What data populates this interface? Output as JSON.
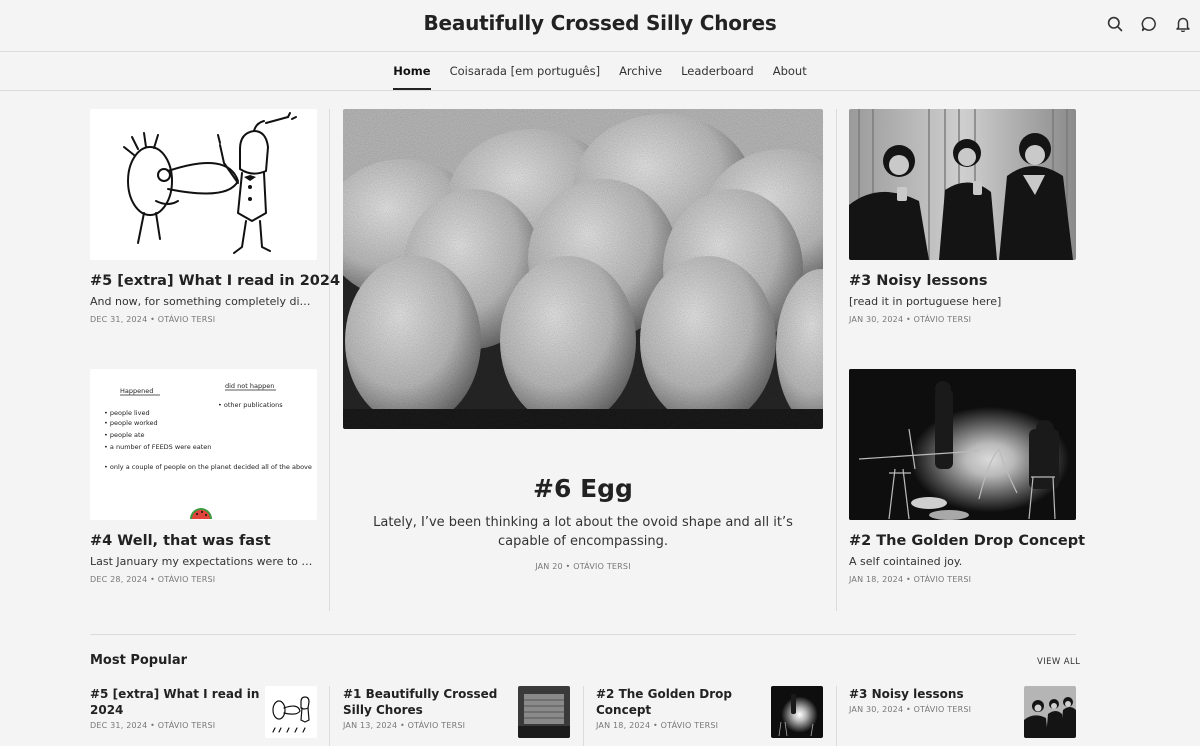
{
  "header": {
    "site_title": "Beautifully Crossed Silly Chores",
    "icons": [
      "search-icon",
      "chat-icon",
      "bell-icon"
    ]
  },
  "nav": {
    "items": [
      {
        "label": "Home",
        "active": true
      },
      {
        "label": "Coisarada [em português]",
        "active": false
      },
      {
        "label": "Archive",
        "active": false
      },
      {
        "label": "Leaderboard",
        "active": false
      },
      {
        "label": "About",
        "active": false
      }
    ]
  },
  "featured": {
    "title": "#6 Egg",
    "subtitle": "Lately, I’ve been thinking a lot about the ovoid shape and all it’s capable of encompassing.",
    "meta": "JAN 20 • OTÁVIO TERSI"
  },
  "left_posts": [
    {
      "title": "#5 [extra] What I read in 2024",
      "subtitle": "And now, for something completely different:",
      "meta": "DEC 31, 2024 • OTÁVIO TERSI"
    },
    {
      "title": "#4 Well, that was fast",
      "subtitle": "Last January my expectations were to poke fun at my work routine as a game designer.",
      "meta": "DEC 28, 2024 • OTÁVIO TERSI"
    }
  ],
  "right_posts": [
    {
      "title": "#3 Noisy lessons",
      "subtitle": "[read it in portuguese here]",
      "meta": "JAN 30, 2024 • OTÁVIO TERSI"
    },
    {
      "title": "#2 The Golden Drop Concept",
      "subtitle": "A self cointained joy.",
      "meta": "JAN 18, 2024 • OTÁVIO TERSI"
    }
  ],
  "sketch_text": {
    "happened": "Happened",
    "did_not_happen": "did not happen",
    "list": [
      "people lived",
      "people worked",
      "people ate",
      "a number of FEEDS were eaten",
      "only a couple of people on the planet decided all of the above"
    ],
    "other": "other publications"
  },
  "popular": {
    "heading": "Most Popular",
    "view_all": "VIEW ALL",
    "items": [
      {
        "title": "#5 [extra] What I read in 2024",
        "meta": "DEC 31, 2024 • OTÁVIO TERSI"
      },
      {
        "title": "#1 Beautifully Crossed Silly Chores",
        "meta": "JAN 13, 2024 • OTÁVIO TERSI"
      },
      {
        "title": "#2 The Golden Drop Concept",
        "meta": "JAN 18, 2024 • OTÁVIO TERSI"
      },
      {
        "title": "#3 Noisy lessons",
        "meta": "JAN 30, 2024 • OTÁVIO TERSI"
      }
    ]
  }
}
